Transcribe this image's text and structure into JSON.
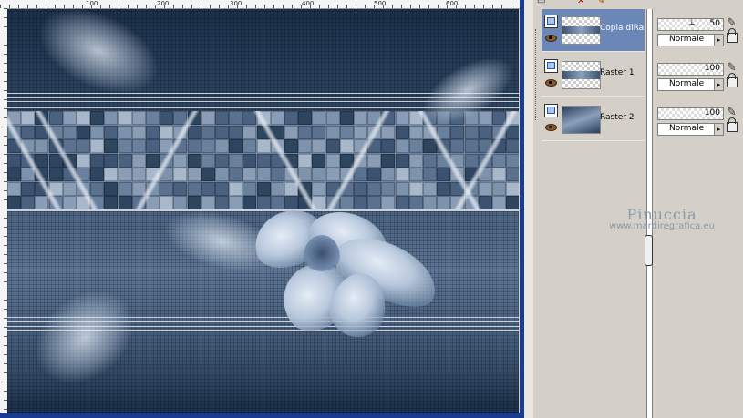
{
  "rulers": {
    "top_ticks": [
      "100",
      "200",
      "300",
      "400",
      "500",
      "600"
    ]
  },
  "layers_palette": {
    "toolbar_icons": [
      "new-layer-icon",
      "delete-layer-icon",
      "mask-icon"
    ],
    "layers": [
      {
        "name": "Copia diRas",
        "opacity": "50",
        "blend_mode": "Normale",
        "selected": true
      },
      {
        "name": "Raster 1",
        "opacity": "100",
        "blend_mode": "Normale",
        "selected": false
      },
      {
        "name": "Raster 2",
        "opacity": "100",
        "blend_mode": "Normale",
        "selected": false
      }
    ]
  },
  "watermark": {
    "name": "Pinuccia",
    "url": "www.mardiregrafica.eu"
  },
  "colors": {
    "selected_row": "#6a87b8",
    "canvas_dark": "#1a2f4a",
    "scrollbar": "#1a3c90"
  }
}
